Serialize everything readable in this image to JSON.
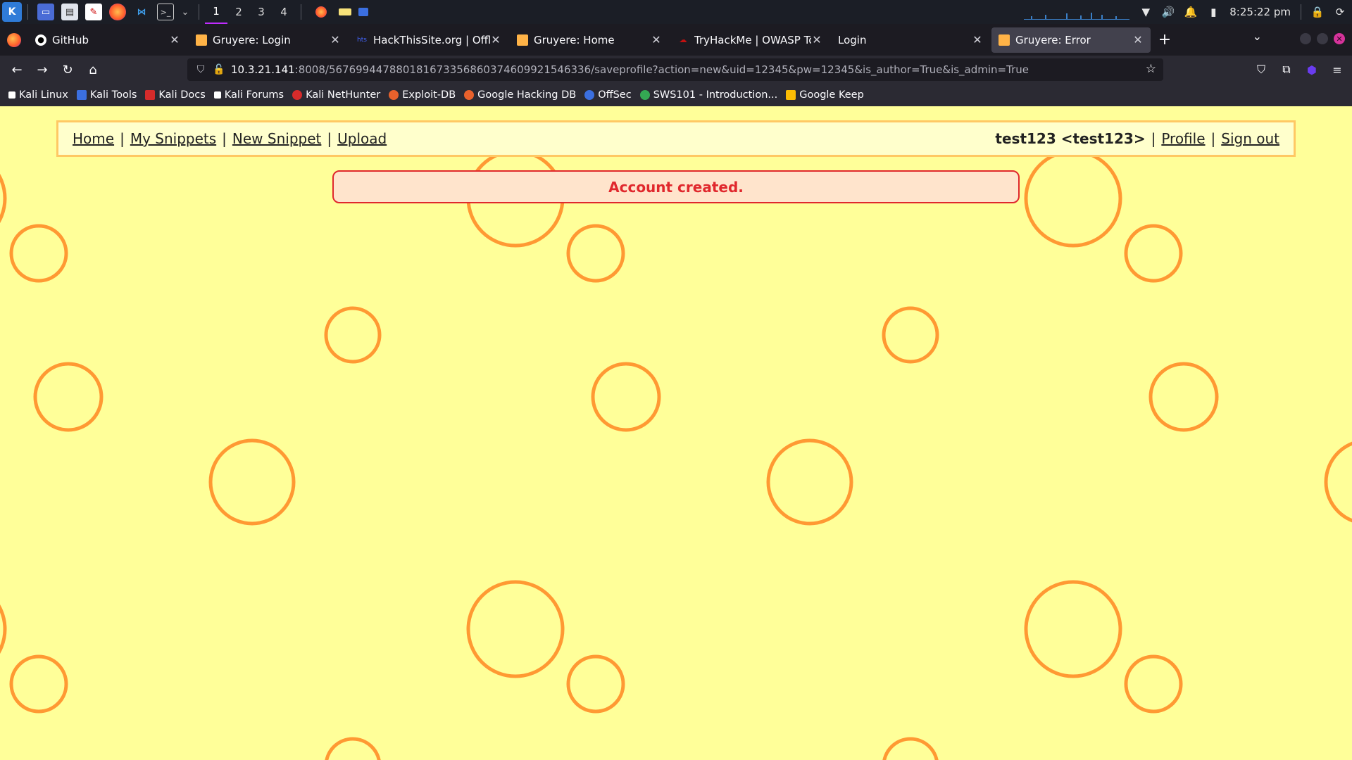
{
  "os_panel": {
    "workspaces": [
      "1",
      "2",
      "3",
      "4"
    ],
    "active_workspace": "1",
    "clock": "8:25:22 pm",
    "apps": [
      {
        "icon": "terminal-window-icon",
        "color": "#4a6cd6"
      },
      {
        "icon": "file-manager-icon",
        "color": "#e0e4ec"
      },
      {
        "icon": "text-editor-icon",
        "color": "#ffffff"
      },
      {
        "icon": "firefox-icon",
        "color": "#ff7139"
      },
      {
        "icon": "vscode-icon",
        "color": "#3fa1f0"
      },
      {
        "icon": "terminal-icon",
        "color": "#cccccc"
      }
    ]
  },
  "browser": {
    "tabs": [
      {
        "title": "GitHub",
        "icon": "github-icon",
        "color": "#ffffff",
        "active": false
      },
      {
        "title": "Gruyere: Login",
        "icon": "gruyere-icon",
        "color": "#ffb347",
        "active": false
      },
      {
        "title": "HackThisSite.org | Offline",
        "icon": "hackthissite-icon",
        "color": "#4466ff",
        "active": false
      },
      {
        "title": "Gruyere: Home",
        "icon": "gruyere-icon",
        "color": "#ffb347",
        "active": false
      },
      {
        "title": "TryHackMe | OWASP Top",
        "icon": "tryhackme-icon",
        "color": "#c11111",
        "active": false
      },
      {
        "title": "Login",
        "icon": "",
        "color": "",
        "active": false
      },
      {
        "title": "Gruyere: Error",
        "icon": "gruyere-icon",
        "color": "#ffb347",
        "active": true
      }
    ],
    "url": {
      "host": "10.3.21.141",
      "rest": ":8008/5676994478801816733568603746099215463​36/saveprofile?action=new&uid=12345&pw=12345&is_author=True&is_admin=True"
    },
    "bookmarks": [
      {
        "label": "Kali Linux",
        "icon": "kali-icon",
        "color": "#ffffff"
      },
      {
        "label": "Kali Tools",
        "icon": "kali-tools-icon",
        "color": "#3b6fe0"
      },
      {
        "label": "Kali Docs",
        "icon": "kali-docs-icon",
        "color": "#d62b2b"
      },
      {
        "label": "Kali Forums",
        "icon": "kali-forums-icon",
        "color": "#ffffff"
      },
      {
        "label": "Kali NetHunter",
        "icon": "nethunter-icon",
        "color": "#d62b2b"
      },
      {
        "label": "Exploit-DB",
        "icon": "exploit-db-icon",
        "color": "#e8612c"
      },
      {
        "label": "Google Hacking DB",
        "icon": "ghdb-icon",
        "color": "#e8612c"
      },
      {
        "label": "OffSec",
        "icon": "offsec-icon",
        "color": "#3b6fe0"
      },
      {
        "label": "SWS101 - Introduction...",
        "icon": "sws101-icon",
        "color": "#34a853"
      },
      {
        "label": "Google Keep",
        "icon": "google-keep-icon",
        "color": "#fbbc04"
      }
    ]
  },
  "page": {
    "menu": {
      "home": "Home",
      "my_snippets": "My Snippets",
      "new_snippet": "New Snippet",
      "upload": "Upload",
      "user": "test123 <test123>",
      "profile": "Profile",
      "sign_out": "Sign out",
      "separator": "|"
    },
    "message": "Account created.",
    "colors": {
      "background": "#ffff99",
      "circle": "#ff9933",
      "message_text": "#e0282d"
    }
  }
}
